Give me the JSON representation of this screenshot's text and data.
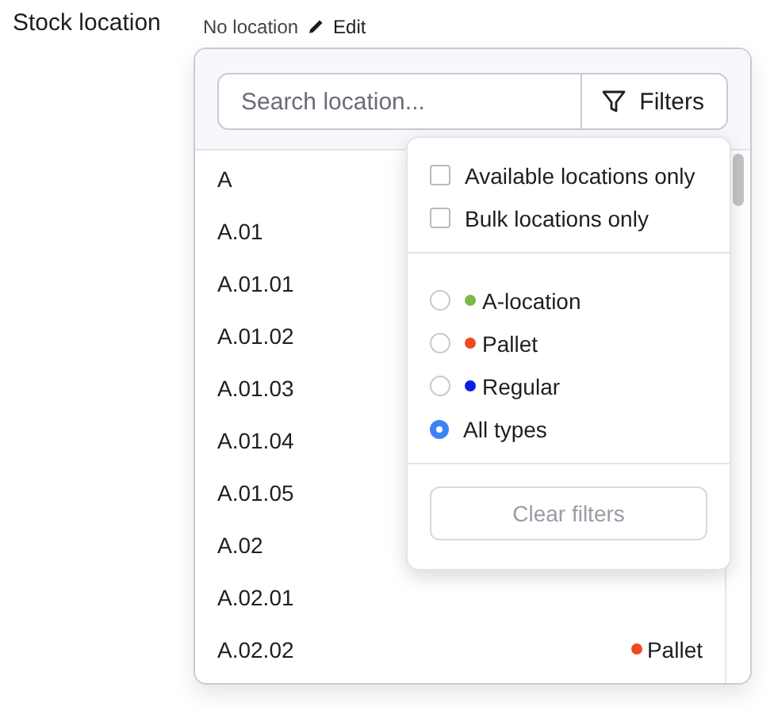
{
  "field": {
    "label": "Stock location",
    "value": "No location",
    "edit_label": "Edit"
  },
  "search": {
    "placeholder": "Search location..."
  },
  "filters_button": {
    "label": "Filters"
  },
  "locations": [
    {
      "name": "A"
    },
    {
      "name": "A.01"
    },
    {
      "name": "A.01.01"
    },
    {
      "name": "A.01.02"
    },
    {
      "name": "A.01.03"
    },
    {
      "name": "A.01.04"
    },
    {
      "name": "A.01.05"
    },
    {
      "name": "A.02"
    },
    {
      "name": "A.02.01"
    },
    {
      "name": "A.02.02",
      "type": "Pallet",
      "color": "#f04a1e"
    }
  ],
  "filters_popover": {
    "checkboxes": [
      {
        "label": "Available locations only",
        "checked": false
      },
      {
        "label": "Bulk locations only",
        "checked": false
      }
    ],
    "types": [
      {
        "label": "A-location",
        "color": "#7bb84a",
        "selected": false
      },
      {
        "label": "Pallet",
        "color": "#f04a1e",
        "selected": false
      },
      {
        "label": "Regular",
        "color": "#0a1ee6",
        "selected": false
      },
      {
        "label": "All types",
        "selected": true
      }
    ],
    "clear_button": {
      "label": "Clear filters",
      "disabled": true
    }
  }
}
